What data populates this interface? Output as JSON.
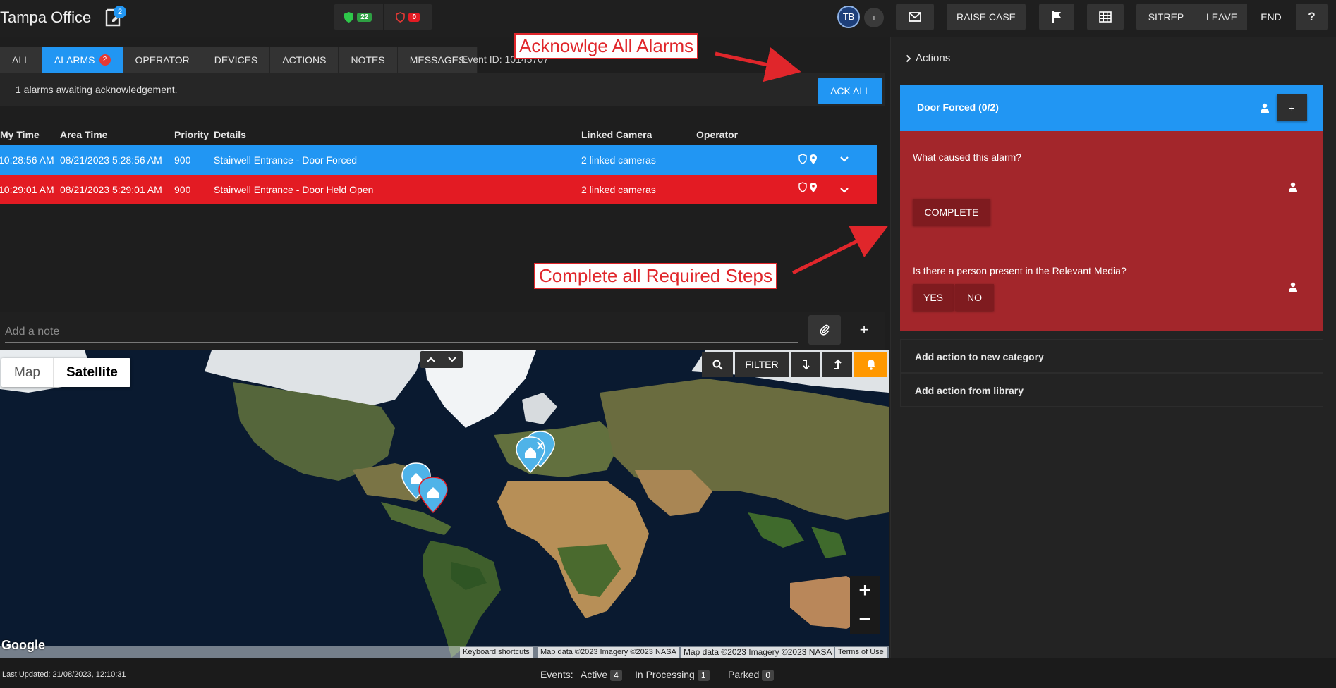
{
  "header": {
    "title": "Tampa Office",
    "notes_count": "2",
    "status_ok_count": "22",
    "status_alert_count": "0",
    "user_initials": "TB",
    "add_user": "+",
    "raise_case": "RAISE CASE",
    "sitrep": "SITREP",
    "leave": "LEAVE",
    "end": "END",
    "help": "?"
  },
  "tabs": [
    {
      "label": "ALL"
    },
    {
      "label": "ALARMS",
      "badge": "2"
    },
    {
      "label": "OPERATOR"
    },
    {
      "label": "DEVICES"
    },
    {
      "label": "ACTIONS"
    },
    {
      "label": "NOTES"
    },
    {
      "label": "MESSAGES"
    }
  ],
  "event_id": "Event ID: 10145707",
  "ack": {
    "message": "1 alarms awaiting acknowledgement.",
    "button": "ACK ALL"
  },
  "alarms_table": {
    "columns": [
      "My Time",
      "Area Time",
      "Priority",
      "Details",
      "Linked Camera",
      "Operator"
    ],
    "rows": [
      {
        "my_time": "10:28:56 AM",
        "area_time": "08/21/2023 5:28:56 AM",
        "priority": "900",
        "details": "Stairwell Entrance - Door Forced",
        "camera": "2 linked cameras",
        "operator": "",
        "color": "#2196f3"
      },
      {
        "my_time": "10:29:01 AM",
        "area_time": "08/21/2023 5:29:01 AM",
        "priority": "900",
        "details": "Stairwell Entrance - Door Held Open",
        "camera": "2 linked cameras",
        "operator": "",
        "color": "#e31b23"
      }
    ]
  },
  "note": {
    "placeholder": "Add a note",
    "add": "+"
  },
  "map": {
    "map_label": "Map",
    "satellite_label": "Satellite",
    "filter": "FILTER",
    "zoom_in": "+",
    "zoom_out": "−",
    "google": "Google",
    "shortcuts": "Keyboard shortcuts",
    "map_data_1": "Map data ©2023 Imagery ©2023 NASA",
    "map_data_2": "Map data ©2023 Imagery ©2023 NASA",
    "terms": "Terms of Use"
  },
  "actions_panel": {
    "header": "Actions",
    "category_title": "Door Forced (0/2)",
    "category_add": "+",
    "step1_question": "What caused this alarm?",
    "step1_button": "COMPLETE",
    "step2_question": "Is there a person present in the Relevant Media?",
    "step2_yes": "YES",
    "step2_no": "NO",
    "add_category": "Add action to new category",
    "add_library": "Add action from library"
  },
  "footer": {
    "last_updated": "Last Updated: 21/08/2023, 12:10:31",
    "events_label": "Events:",
    "active_label": "Active",
    "active_count": "4",
    "processing_label": "In Processing",
    "processing_count": "1",
    "parked_label": "Parked",
    "parked_count": "0"
  },
  "annotations": {
    "ack_callout": "Acknowlge All Alarms",
    "steps_callout": "Complete all Required Steps"
  },
  "colors": {
    "accent": "#2196f3",
    "alarm_red": "#e31b23",
    "step_red": "#a3262b",
    "callout_red": "#e0262b"
  }
}
